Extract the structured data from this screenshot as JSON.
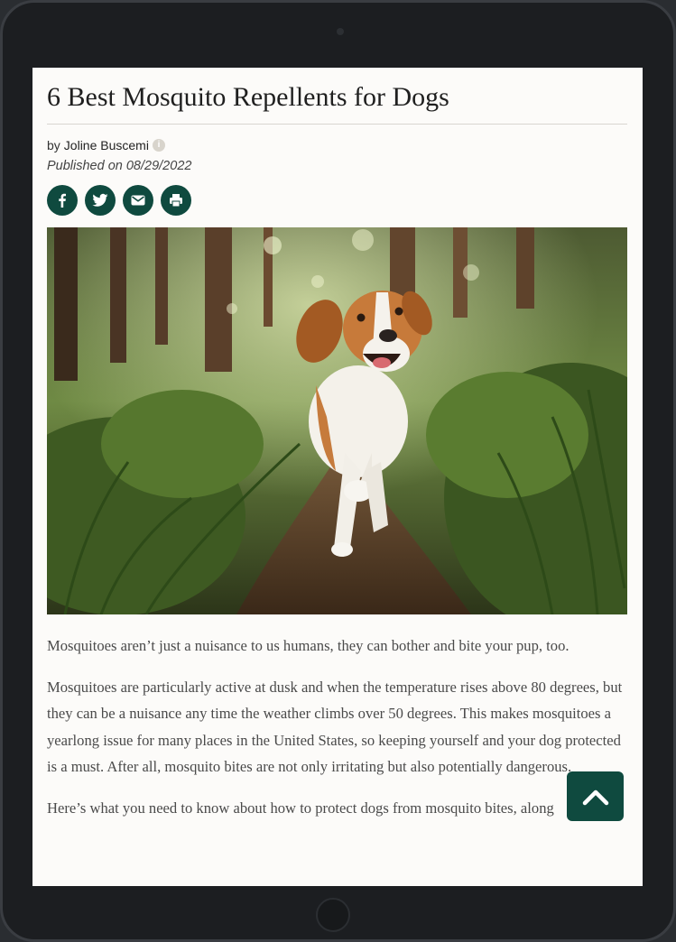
{
  "article": {
    "title": "6 Best Mosquito Repellents for Dogs",
    "byline_prefix": "by",
    "author": "Joline Buscemi",
    "published": "Published on 08/29/2022",
    "hero_image_alt": "Beagle running on a forest path",
    "paragraphs": [
      "Mosquitoes aren’t just a nuisance to us humans, they can bother and bite your pup, too.",
      "Mosquitoes are particularly active at dusk and when the temperature rises above 80 degrees, but they can be a nuisance any time the weather climbs over 50 degrees. This makes mosquitoes a yearlong issue for many places in the United States, so keeping yourself and your dog protected is a must. After all, mosquito bites are not only irritating but also potentially dangerous.",
      "Here’s what you need to know about how to protect dogs from mosquito bites, along"
    ]
  },
  "share": {
    "icons": [
      "facebook-icon",
      "twitter-icon",
      "email-icon",
      "print-icon"
    ]
  },
  "colors": {
    "accent": "#0f4a3f",
    "page_bg": "#fcfbf9",
    "text": "#4a4a4a",
    "device": "#1c1e21"
  }
}
